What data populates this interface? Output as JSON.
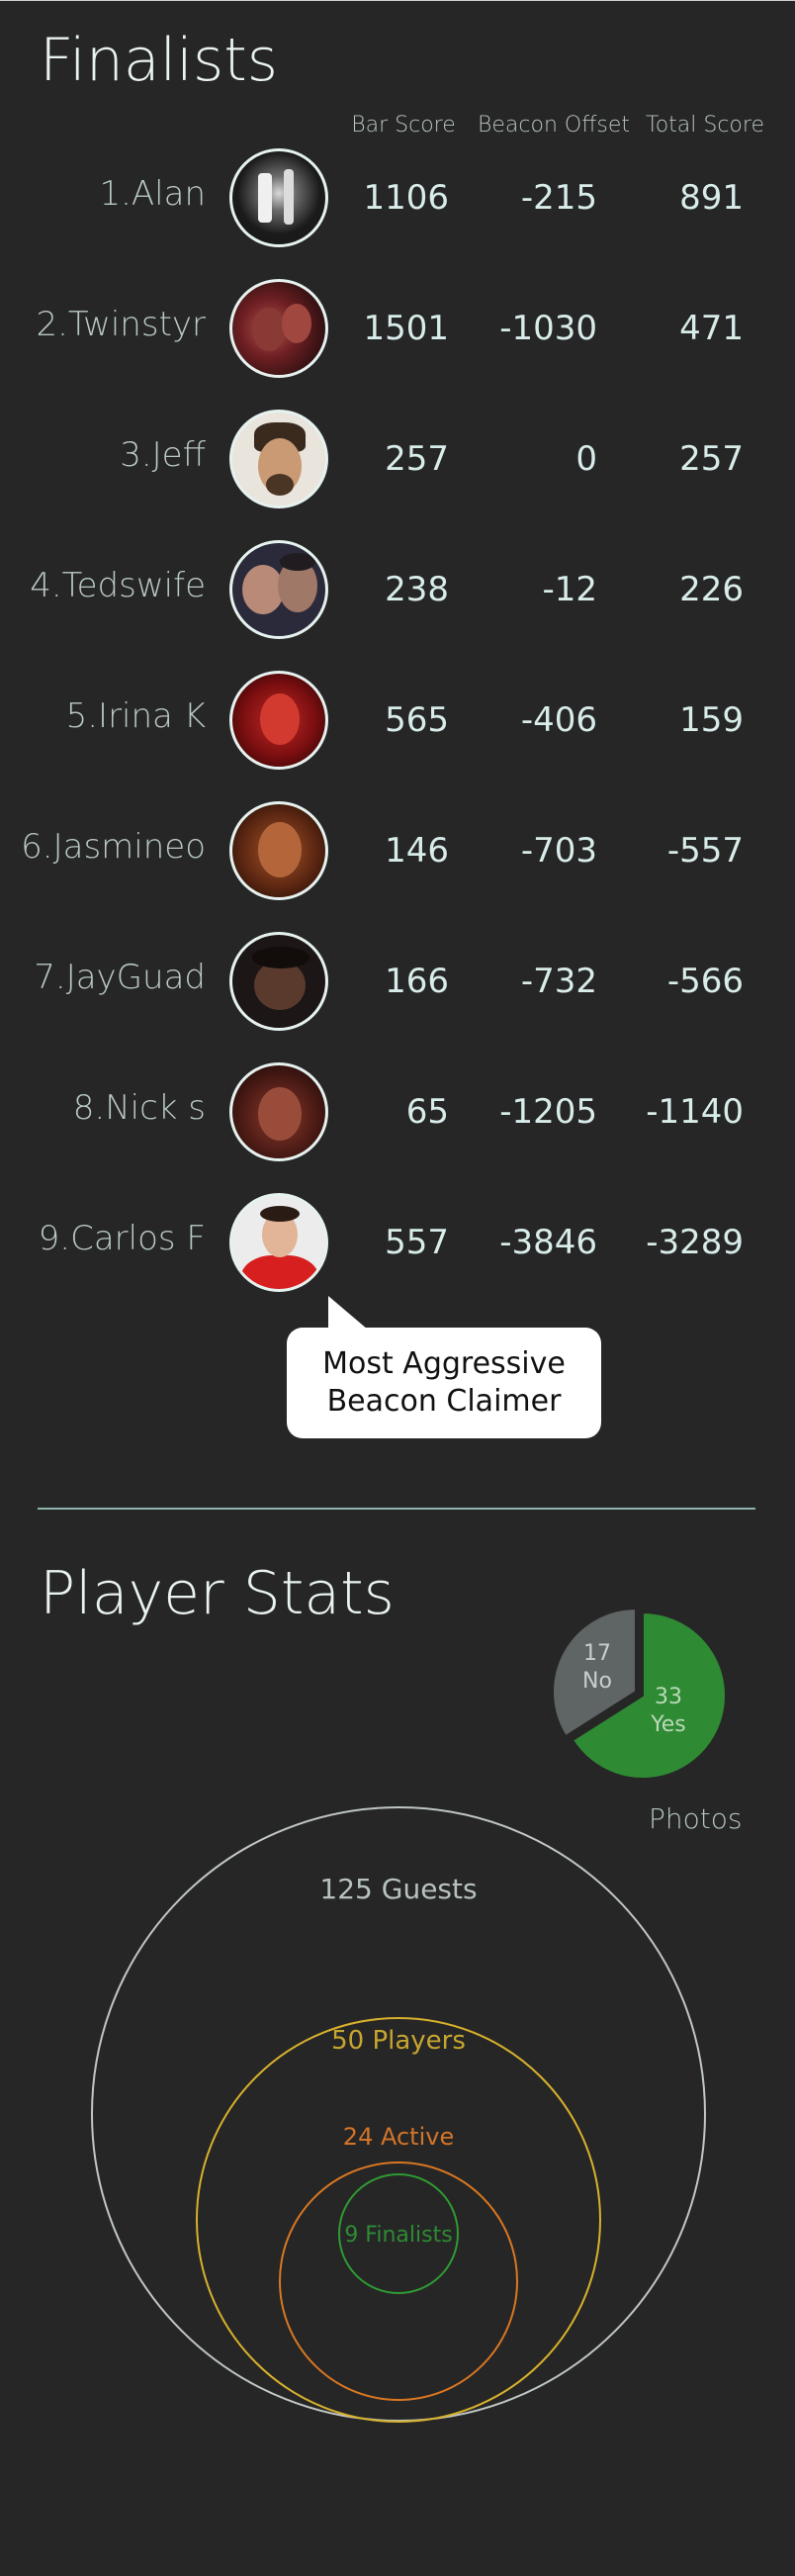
{
  "finalists": {
    "title": "Finalists",
    "columns": [
      "Bar Score",
      "Beacon Offset",
      "Total Score"
    ],
    "rows": [
      {
        "rank_name": "1.Alan",
        "bar": "1106",
        "offset": "-215",
        "total": "891",
        "avatar": "alan-photo"
      },
      {
        "rank_name": "2.Twinstyr",
        "bar": "1501",
        "offset": "-1030",
        "total": "471",
        "avatar": "twinstyr-photo"
      },
      {
        "rank_name": "3.Jeff",
        "bar": "257",
        "offset": "0",
        "total": "257",
        "avatar": "jeff-photo"
      },
      {
        "rank_name": "4.Tedswife",
        "bar": "238",
        "offset": "-12",
        "total": "226",
        "avatar": "tedswife-photo"
      },
      {
        "rank_name": "5.Irina K",
        "bar": "565",
        "offset": "-406",
        "total": "159",
        "avatar": "irina-photo"
      },
      {
        "rank_name": "6.Jasmineo",
        "bar": "146",
        "offset": "-703",
        "total": "-557",
        "avatar": "jasmineo-photo"
      },
      {
        "rank_name": "7.JayGuad",
        "bar": "166",
        "offset": "-732",
        "total": "-566",
        "avatar": "jayguad-photo"
      },
      {
        "rank_name": "8.Nick s",
        "bar": "65",
        "offset": "-1205",
        "total": "-1140",
        "avatar": "nick-photo"
      },
      {
        "rank_name": "9.Carlos F",
        "bar": "557",
        "offset": "-3846",
        "total": "-3289",
        "avatar": "carlos-photo"
      }
    ],
    "callout_line1": "Most Aggressive",
    "callout_line2": "Beacon Claimer"
  },
  "stats": {
    "title": "Player Stats",
    "photos_label": "Photos",
    "photos_no_count": "17",
    "photos_no_label": "No",
    "photos_yes_count": "33",
    "photos_yes_label": "Yes",
    "guests_label": "125 Guests",
    "players_label": "50 Players",
    "active_label": "24 Active",
    "finalists_label": "9 Finalists"
  },
  "chart_data": [
    {
      "type": "pie",
      "title": "Photos",
      "categories": [
        "No",
        "Yes"
      ],
      "values": [
        17,
        33
      ],
      "colors": [
        "#5f6464",
        "#2f8a34"
      ]
    }
  ],
  "colors": {
    "background": "#262626",
    "guests_ring": "#bfc6c4",
    "players_ring": "#d7b12c",
    "active_ring": "#d97722",
    "finalists_ring": "#2f9a33"
  }
}
